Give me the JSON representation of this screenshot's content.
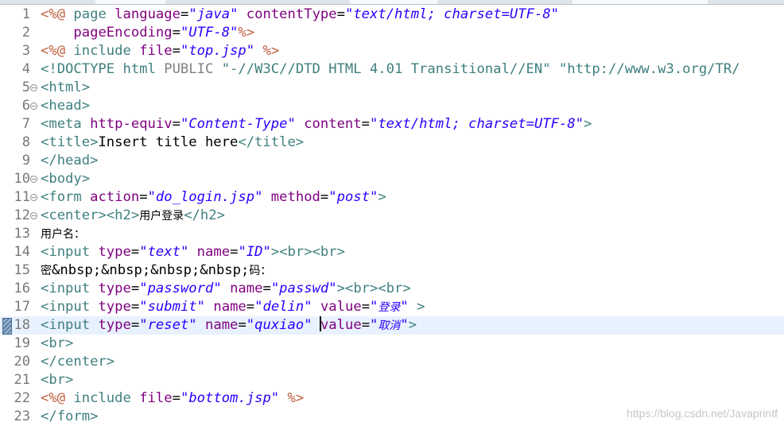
{
  "editor": {
    "lines": [
      {
        "n": "1",
        "fold": false,
        "html": "<span class=\"d\">&lt;%@</span> <span class=\"k\">page</span> <span class=\"a\">language</span>=<span class=\"v\">\"java\"</span> <span class=\"a\">contentType</span>=<span class=\"v\">\"text/html; charset=UTF-8\"</span>"
      },
      {
        "n": "2",
        "fold": false,
        "html": "    <span class=\"a\">pageEncoding</span>=<span class=\"v\">\"UTF-8\"</span><span class=\"d\">%&gt;</span>"
      },
      {
        "n": "3",
        "fold": false,
        "html": "<span class=\"d\">&lt;%@</span> <span class=\"k\">include</span> <span class=\"a\">file</span>=<span class=\"v\">\"top.jsp\"</span> <span class=\"d\">%&gt;</span>"
      },
      {
        "n": "4",
        "fold": false,
        "html": "<span class=\"k\">&lt;!DOCTYPE html</span> <span class=\"g\">PUBLIC</span> <span class=\"k\">\"-//W3C//DTD HTML 4.01 Transitional//EN\" \"http://www.w3.org/TR/</span>"
      },
      {
        "n": "5",
        "fold": true,
        "html": "<span class=\"k\">&lt;html&gt;</span>"
      },
      {
        "n": "6",
        "fold": true,
        "html": "<span class=\"k\">&lt;head&gt;</span>"
      },
      {
        "n": "7",
        "fold": false,
        "html": "<span class=\"k\">&lt;meta</span> <span class=\"a\">http-equiv</span>=<span class=\"v\">\"Content-Type\"</span> <span class=\"a\">content</span>=<span class=\"v\">\"text/html; charset=UTF-8\"</span><span class=\"k\">&gt;</span>"
      },
      {
        "n": "8",
        "fold": false,
        "html": "<span class=\"k\">&lt;title&gt;</span><span class=\"t\">Insert title here</span><span class=\"k\">&lt;/title&gt;</span>"
      },
      {
        "n": "9",
        "fold": false,
        "html": "<span class=\"k\">&lt;/head&gt;</span>"
      },
      {
        "n": "10",
        "fold": true,
        "html": "<span class=\"k\">&lt;body&gt;</span>"
      },
      {
        "n": "11",
        "fold": true,
        "html": "<span class=\"k\">&lt;form</span> <span class=\"a\">action</span>=<span class=\"v\">\"do_login.jsp\"</span> <span class=\"a\">method</span>=<span class=\"v\">\"post\"</span><span class=\"k\">&gt;</span>"
      },
      {
        "n": "12",
        "fold": true,
        "html": "<span class=\"k\">&lt;center&gt;&lt;h2&gt;</span><span class=\"t cn\">用户登录</span><span class=\"k\">&lt;/h2&gt;</span>"
      },
      {
        "n": "13",
        "fold": false,
        "html": "<span class=\"t cn\">用户名：</span>"
      },
      {
        "n": "14",
        "fold": false,
        "html": "<span class=\"k\">&lt;input</span> <span class=\"a\">type</span>=<span class=\"v\">\"text\"</span> <span class=\"a\">name</span>=<span class=\"v\">\"ID\"</span><span class=\"k\">&gt;&lt;br&gt;&lt;br&gt;</span>"
      },
      {
        "n": "15",
        "fold": false,
        "html": "<span class=\"t cn\">密</span><span class=\"t\">&amp;nbsp;&amp;nbsp;&amp;nbsp;&amp;nbsp;</span><span class=\"t cn\">码：</span>"
      },
      {
        "n": "16",
        "fold": false,
        "html": "<span class=\"k\">&lt;input</span> <span class=\"a\">type</span>=<span class=\"v\">\"password\"</span> <span class=\"a\">name</span>=<span class=\"v\">\"passwd\"</span><span class=\"k\">&gt;&lt;br&gt;&lt;br&gt;</span>"
      },
      {
        "n": "17",
        "fold": false,
        "html": "<span class=\"k\">&lt;input</span> <span class=\"a\">type</span>=<span class=\"v\">\"submit\"</span> <span class=\"a\">name</span>=<span class=\"v\">\"delin\"</span> <span class=\"a\">value</span>=<span class=\"v\">\"<span class=\"cn\">登录</span>\"</span> <span class=\"k\">&gt;</span>"
      },
      {
        "n": "18",
        "fold": false,
        "current": true,
        "bookmark": true,
        "html": "<span class=\"k\">&lt;input</span> <span class=\"a\">type</span>=<span class=\"v\">\"reset\"</span> <span class=\"a\">name</span>=<span class=\"v\">\"quxiao\"</span> <span class=\"caret\"></span><span class=\"a\">value</span>=<span class=\"v\">\"<span class=\"cn\">取消</span>\"</span><span class=\"k\">&gt;</span>"
      },
      {
        "n": "19",
        "fold": false,
        "html": "<span class=\"k\">&lt;br&gt;</span>"
      },
      {
        "n": "20",
        "fold": false,
        "html": "<span class=\"k\">&lt;/center&gt;</span>"
      },
      {
        "n": "21",
        "fold": false,
        "html": "<span class=\"k\">&lt;br&gt;</span>"
      },
      {
        "n": "22",
        "fold": false,
        "html": "<span class=\"d\">&lt;%@</span> <span class=\"k\">include</span> <span class=\"a\">file</span>=<span class=\"v\">\"bottom.jsp\"</span> <span class=\"d\">%&gt;</span>"
      },
      {
        "n": "23",
        "fold": false,
        "html": "<span class=\"k\">&lt;/form&gt;</span>"
      }
    ]
  },
  "watermark": "https://blog.csdn.net/Javaprintf",
  "colors": {
    "jsp_delimiter": "#bf5f3f",
    "tag": "#3f7f7f",
    "attribute": "#7f007f",
    "value": "#2a00ff",
    "current_line": "#e8f2fe"
  }
}
